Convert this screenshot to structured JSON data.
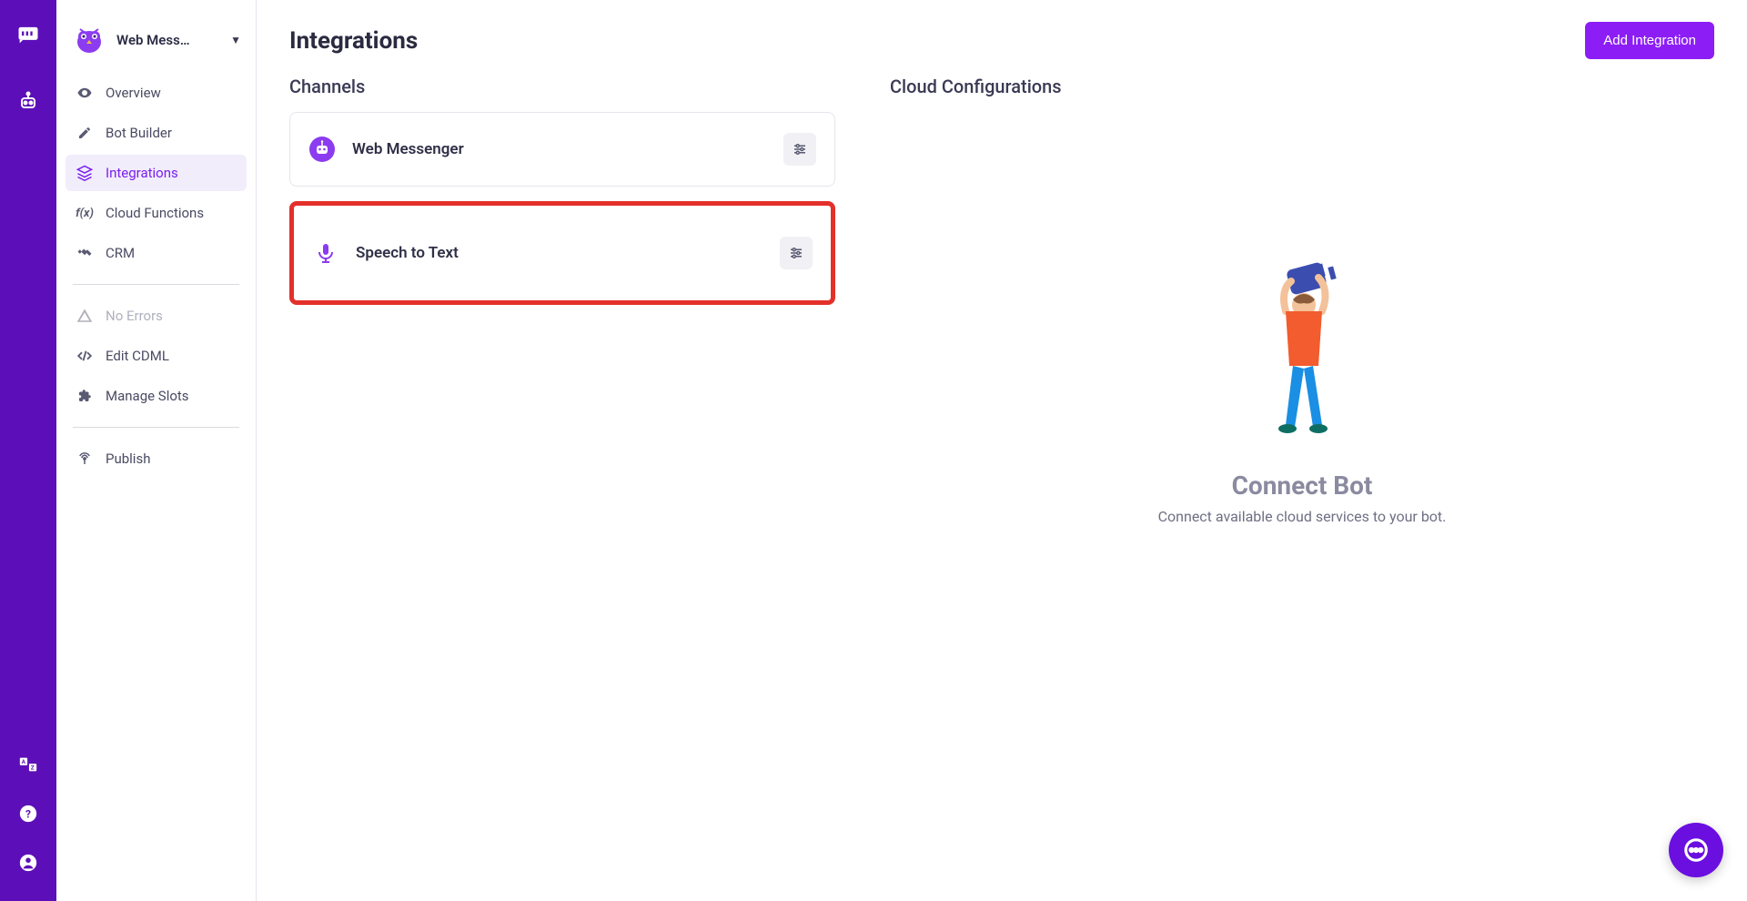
{
  "rail": {
    "icons": [
      "chat-bubble-icon",
      "bot-icon",
      "translate-icon",
      "help-icon",
      "profile-icon"
    ]
  },
  "sidebar": {
    "bot_name": "Web Mess…",
    "items": [
      {
        "label": "Overview",
        "icon": "eye-icon",
        "active": false
      },
      {
        "label": "Bot Builder",
        "icon": "pencil-icon",
        "active": false
      },
      {
        "label": "Integrations",
        "icon": "layers-icon",
        "active": true
      },
      {
        "label": "Cloud Functions",
        "icon": "fx-icon",
        "active": false
      },
      {
        "label": "CRM",
        "icon": "handshake-icon",
        "active": false
      }
    ],
    "status_item": {
      "label": "No Errors",
      "icon": "warning-icon"
    },
    "tools": [
      {
        "label": "Edit CDML",
        "icon": "code-icon"
      },
      {
        "label": "Manage Slots",
        "icon": "puzzle-icon"
      }
    ],
    "publish": {
      "label": "Publish",
      "icon": "broadcast-icon"
    }
  },
  "header": {
    "title": "Integrations",
    "add_button": "Add Integration"
  },
  "channels": {
    "title": "Channels",
    "items": [
      {
        "label": "Web Messenger",
        "icon": "bot-circle-icon",
        "highlight": false
      },
      {
        "label": "Speech to Text",
        "icon": "microphone-icon",
        "highlight": true
      }
    ]
  },
  "cloud": {
    "title": "Cloud Configurations",
    "empty_title": "Connect Bot",
    "empty_sub": "Connect available cloud services to your bot."
  }
}
